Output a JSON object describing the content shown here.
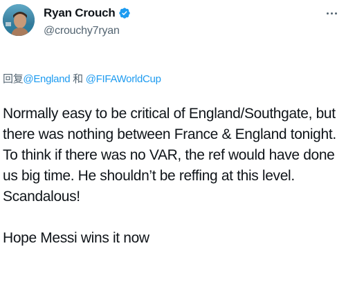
{
  "tweet": {
    "author": {
      "display_name": "Ryan Crouch",
      "handle": "@crouchy7ryan",
      "verified": true,
      "avatar": "profile-photo"
    },
    "menu_icon": "more-horizontal-icon",
    "reply_context": {
      "prefix": "回复",
      "mention_1": "@England",
      "conjunction": "和",
      "mention_2": "@FIFAWorldCup"
    },
    "text_lines": [
      "Normally easy to be critical of England/Southgate, but",
      "there was nothing between France & England tonight.",
      "To think if there was no VAR, the ref would have done",
      "us big time. He shouldn’t be reffing at this level.",
      "Scandalous!"
    ],
    "closing_line": "Hope Messi wins it now"
  },
  "colors": {
    "text": "#0f1419",
    "secondary": "#536471",
    "link": "#1d9bf0",
    "verified": "#1d9bf0"
  }
}
